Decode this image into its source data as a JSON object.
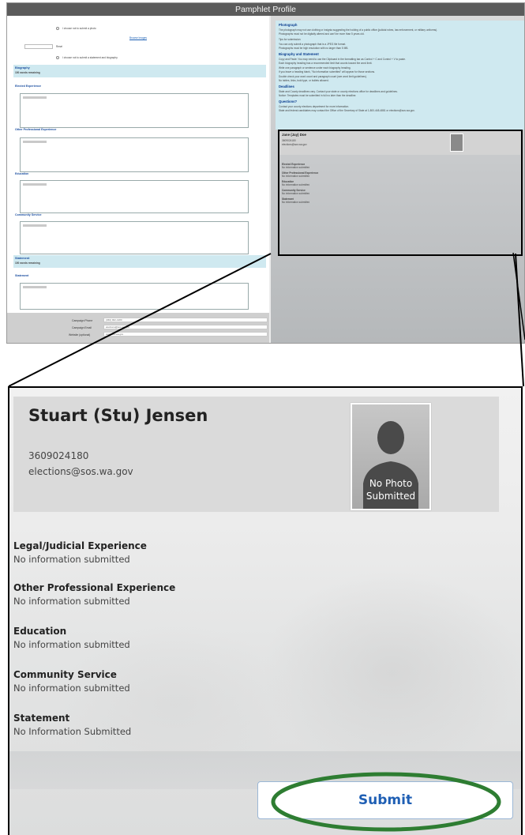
{
  "mini": {
    "title": "Pamphlet Profile",
    "photo_option": "I choose not to submit a photo",
    "browse_label": "Browse Images",
    "reset_label": "Reset",
    "statement_option": "I choose not to submit a statement and biography",
    "biography_header": "Biography",
    "biography_words": "100 words remaining",
    "sections": [
      "Elected Experience",
      "Other Professional Experience",
      "Education",
      "Community Service"
    ],
    "statement_header": "Statement",
    "statement_words": "100 words remaining",
    "statement_label": "Statement",
    "contact_fields": [
      {
        "label": "Campaign Phone",
        "value": "(360) 902-4180"
      },
      {
        "label": "Campaign Email",
        "value": "elections@sos.wa.gov"
      },
      {
        "label": "Website (optional)",
        "value": "www.sos.wa.gov"
      }
    ],
    "info": {
      "photograph_head": "Photograph",
      "photograph_lines": [
        "The photograph may not use clothing or insignia suggesting the holding of a public office (judicial robes, law enforcement, or military uniforms).",
        "Photographs must not be digitally altered and can't be more than 5 years old."
      ],
      "tips_head": "Tips for submission:",
      "tips_lines": [
        "You can only submit a photograph that is a JPEG file format.",
        "Photographs must be high resolution with no larger than 5 MB."
      ],
      "bio_head": "Biography and Statement",
      "bio_lines": [
        "Copy and Paste: You may need to use the Clipboard in the formatting bar as Control + C and Control + V to paste.",
        "Each biography heading has a recommended limit that counts toward the word limit.",
        "Write one paragraph or sentence under each biography heading.",
        "If you leave a heading blank, \"No information submitted\" will appear for those sections.",
        "Double check your word count and paragraph count (see word limit guidelines).",
        "No tables, links, bold type, or bullets allowed."
      ],
      "deadline_head": "Deadlines",
      "deadline_lines": [
        "State and County deadlines vary. Contact your state or county elections office for deadlines and guidelines.",
        "Notice: Templates must be submitted in full no later than the deadline."
      ],
      "questions_head": "Questions?",
      "questions_lines": [
        "Contact your county elections department for more information.",
        "State and federal candidates may contact the Office of the Secretary of State at 1-800-448-4881 or elections@sos.wa.gov."
      ]
    },
    "preview": {
      "name": "Jane (Jay) Doe",
      "phone": "3609024180",
      "email": "elections@sos.wa.gov",
      "sections": [
        {
          "title": "Elected Experience",
          "value": "No information submitted"
        },
        {
          "title": "Other Professional Experience",
          "value": "No information submitted"
        },
        {
          "title": "Education",
          "value": "No information submitted"
        },
        {
          "title": "Community Service",
          "value": "No information submitted"
        },
        {
          "title": "Statement",
          "value": "No information submitted"
        }
      ]
    }
  },
  "zoom": {
    "name": "Stuart (Stu) Jensen",
    "phone": "3609024180",
    "email": "elections@sos.wa.gov",
    "photo_text_line1": "No Photo",
    "photo_text_line2": "Submitted",
    "sections": [
      {
        "title": "Legal/Judicial Experience",
        "value": "No information submitted"
      },
      {
        "title": "Other Professional Experience",
        "value": "No information submitted"
      },
      {
        "title": "Education",
        "value": "No information submitted"
      },
      {
        "title": "Community Service",
        "value": "No information submitted"
      },
      {
        "title": "Statement",
        "value": "No Information Submitted"
      }
    ],
    "submit_label": "Submit"
  },
  "colors": {
    "highlight": "#2e7d32",
    "accent": "#1f5fb4",
    "band": "#cfe9f0",
    "title_bar": "#5b5b5b"
  }
}
